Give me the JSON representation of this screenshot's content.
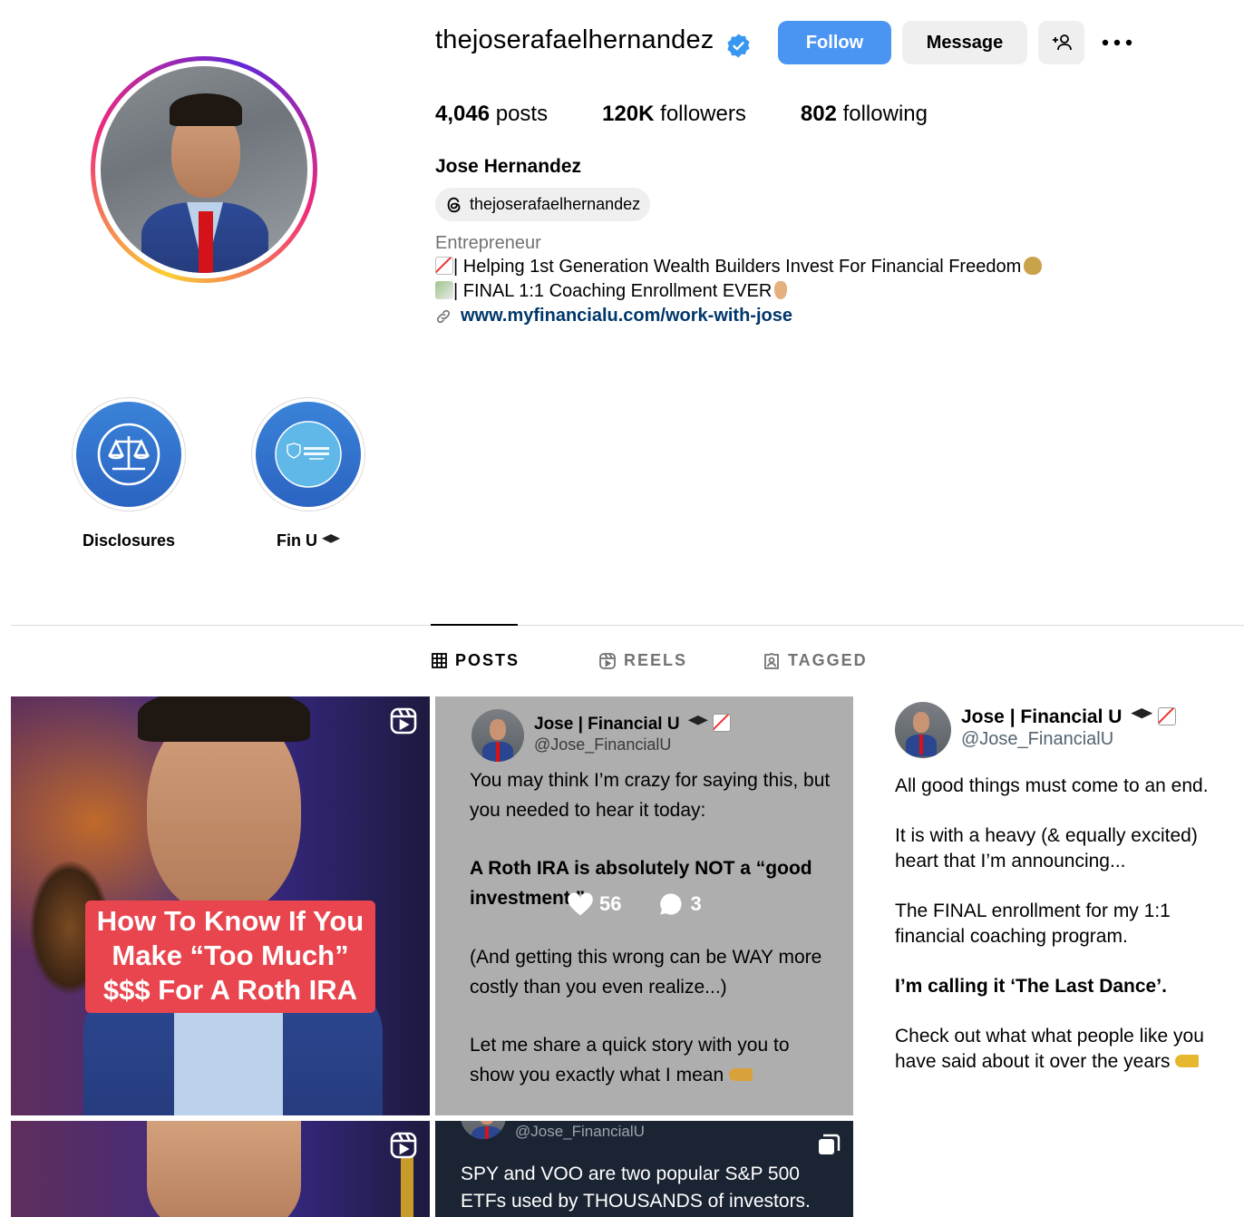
{
  "profile": {
    "username": "thejoserafaelhernandez",
    "full_name": "Jose Hernandez",
    "threads_handle": "thejoserafaelhernandez",
    "category": "Entrepreneur",
    "bio_line1": "| Helping 1st Generation Wealth Builders Invest For Financial Freedom",
    "bio_line2": "| FINAL 1:1 Coaching Enrollment EVER",
    "link": "www.myfinancialu.com/work-with-jose"
  },
  "actions": {
    "follow": "Follow",
    "message": "Message"
  },
  "stats": {
    "posts_count": "4,046",
    "posts_label": "posts",
    "followers_count": "120K",
    "followers_label": "followers",
    "following_count": "802",
    "following_label": "following"
  },
  "highlights": [
    {
      "label": "Disclosures",
      "icon": "scales-icon"
    },
    {
      "label": "Fin U",
      "icon": "financial-university-logo"
    }
  ],
  "tabs": [
    {
      "label": "POSTS",
      "icon": "grid-icon",
      "active": true
    },
    {
      "label": "REELS",
      "icon": "reels-icon",
      "active": false
    },
    {
      "label": "TAGGED",
      "icon": "tagged-icon",
      "active": false
    }
  ],
  "posts": {
    "p1_caption": "How To Know If You Make “Too Much” $$$ For A Roth IRA",
    "p2": {
      "name": "Jose | Financial U",
      "handle": "@Jose_FinancialU",
      "text1": "You may think I’m crazy for saying this, but you needed to hear it today:",
      "text2": "A Roth IRA is absolutely NOT a “good investment.”",
      "text3": "(And getting this wrong can be WAY more costly than you even realize...)",
      "text4": "Let me share a quick story with you to show you exactly what I mean",
      "likes": "56",
      "comments": "3"
    },
    "p3": {
      "name": "Jose | Financial U",
      "handle": "@Jose_FinancialU",
      "text1": "All good things must come to an end.",
      "text2": "It is with a heavy (& equally excited) heart that I’m announcing...",
      "text3": "The FINAL enrollment for my 1:1 financial coaching program.",
      "text4": "I’m calling it ‘The Last Dance’.",
      "text5": "Check out what what people like you have said about it over the years"
    },
    "p5": {
      "handle": "@Jose_FinancialU",
      "text": "SPY and VOO are two popular S&P 500 ETFs used by THOUSANDS of investors."
    }
  },
  "colors": {
    "follow_button": "#4a95f2",
    "verified_badge": "#3897f0",
    "link": "#00376b",
    "caption_bg": "#e8454f",
    "secondary_text": "#737373"
  }
}
